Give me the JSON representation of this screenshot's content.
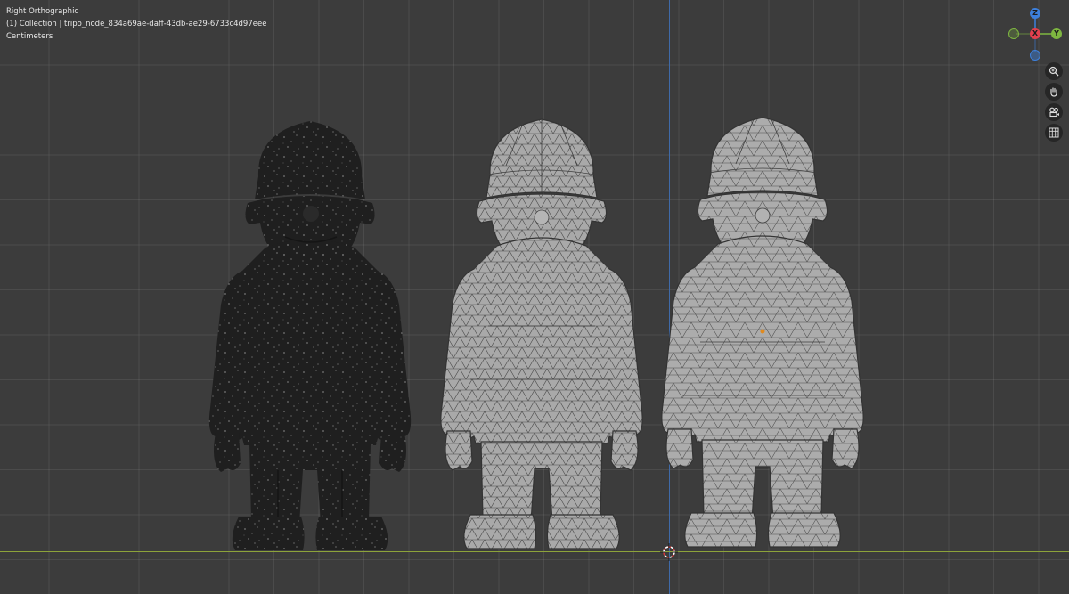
{
  "viewport": {
    "view_name": "Right Orthographic",
    "collection_line": "(1) Collection | tripo_node_834a69ae-daff-43db-ae29-6733c4d97eee",
    "units": "Centimeters"
  },
  "gizmo": {
    "z_label": "Z",
    "x_label": "X",
    "y_label": "Y",
    "colors": {
      "x": "#e2404e",
      "y": "#7eb640",
      "z": "#3d80dc"
    }
  },
  "tools": [
    "zoom-icon",
    "pan-hand-icon",
    "camera-view-icon",
    "grid-toggle-icon"
  ],
  "figures": [
    "figure-dark-shaded",
    "figure-wireframe-dense",
    "figure-wireframe-sparse"
  ]
}
